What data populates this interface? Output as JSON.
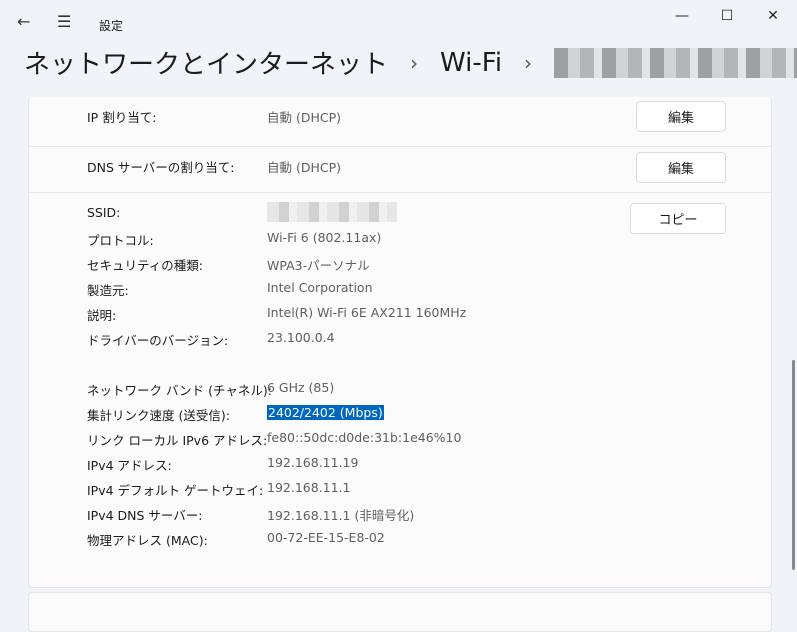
{
  "titlebar": {
    "app_title": "設定"
  },
  "breadcrumb": {
    "section": "ネットワークとインターネット",
    "sub": "Wi-Fi"
  },
  "ip_assignment": {
    "label": "IP 割り当て:",
    "value": "自動 (DHCP)",
    "button": "編集"
  },
  "dns_assignment": {
    "label": "DNS サーバーの割り当て:",
    "value": "自動 (DHCP)",
    "button": "編集"
  },
  "copy_button": "コピー",
  "properties": [
    {
      "label": "SSID:",
      "value": ""
    },
    {
      "label": "プロトコル:",
      "value": "Wi-Fi 6 (802.11ax)"
    },
    {
      "label": "セキュリティの種類:",
      "value": "WPA3-パーソナル"
    },
    {
      "label": "製造元:",
      "value": "Intel Corporation"
    },
    {
      "label": "説明:",
      "value": "Intel(R) Wi-Fi 6E AX211 160MHz"
    },
    {
      "label": "ドライバーのバージョン:",
      "value": "23.100.0.4"
    },
    {
      "label": "ネットワーク バンド (チャネル):",
      "value": "6 GHz (85)"
    },
    {
      "label": "集計リンク速度 (送受信):",
      "value": "2402/2402 (Mbps)"
    },
    {
      "label": "リンク ローカル IPv6 アドレス:",
      "value": "fe80::50dc:d0de:31b:1e46%10"
    },
    {
      "label": "IPv4 アドレス:",
      "value": "192.168.11.19"
    },
    {
      "label": "IPv4 デフォルト ゲートウェイ:",
      "value": "192.168.11.1"
    },
    {
      "label": "IPv4 DNS サーバー:",
      "value": "192.168.11.1 (非暗号化)"
    },
    {
      "label": "物理アドレス (MAC):",
      "value": "00-72-EE-15-E8-02"
    }
  ]
}
